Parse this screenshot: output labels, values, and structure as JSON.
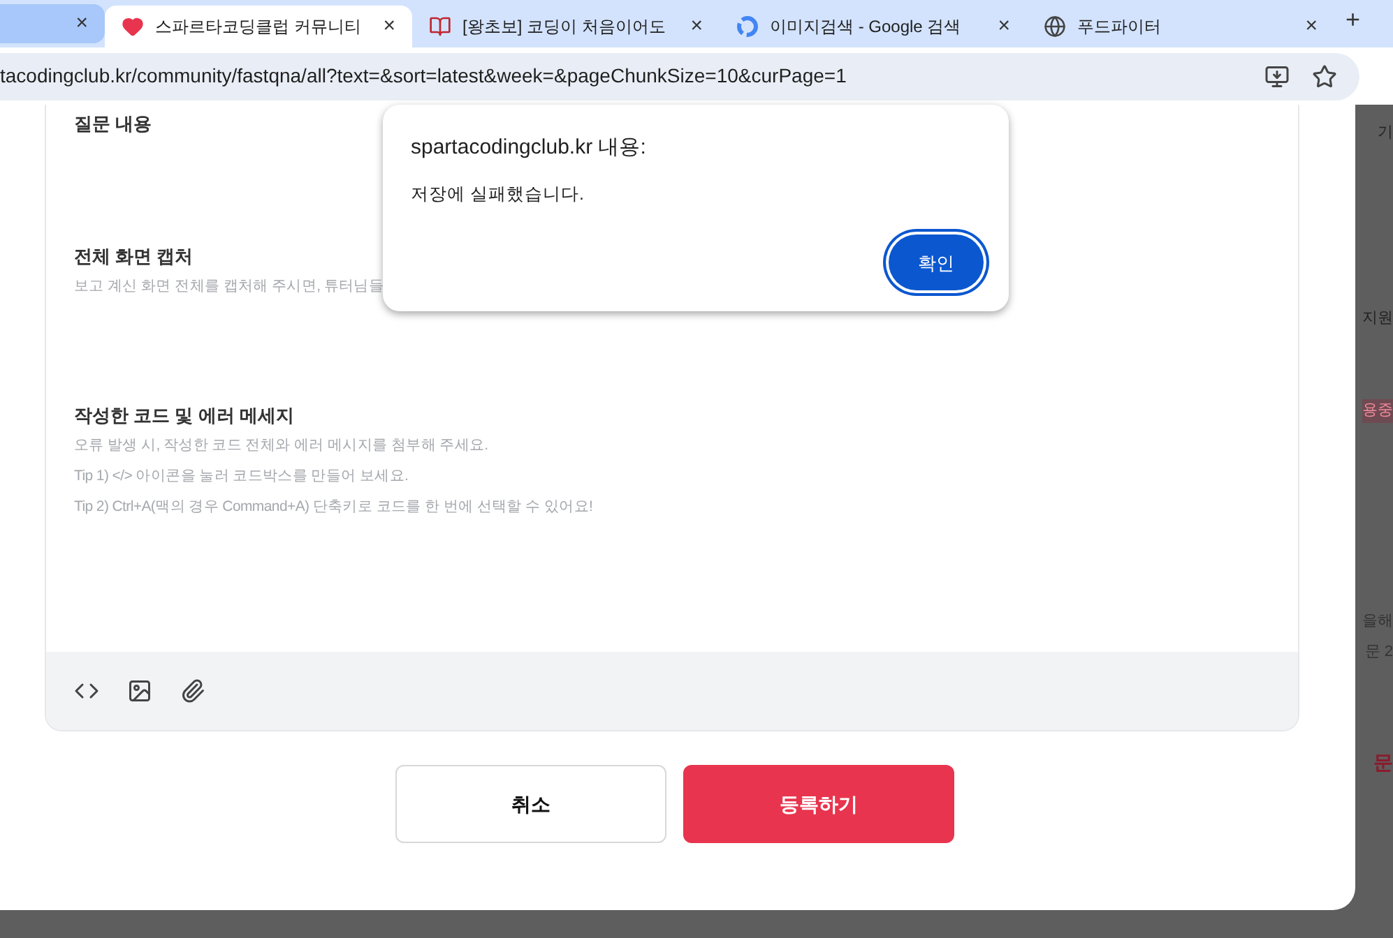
{
  "tabs": [
    {
      "kind": "partial",
      "selected": false,
      "close": "×"
    },
    {
      "kind": "tab",
      "title": "스파르타코딩클럽 커뮤니티",
      "selected": true,
      "close": "×"
    },
    {
      "kind": "tab",
      "title": "[왕초보] 코딩이 처음이어도",
      "selected": false,
      "close": "×"
    },
    {
      "kind": "tab",
      "title": "이미지검색 - Google 검색",
      "selected": false,
      "close": "×"
    },
    {
      "kind": "tab",
      "title": "푸드파이터",
      "selected": false,
      "close": "×"
    }
  ],
  "new_tab": "+",
  "address": "tacodingclub.kr/community/fastqna/all?text=&sort=latest&week=&pageChunkSize=10&curPage=1",
  "editor": {
    "sections": [
      {
        "heading": "질문 내용"
      },
      {
        "heading": "전체 화면 캡처",
        "hints": [
          "보고 계신 화면 전체를 캡처해 주시면, 튜터님들"
        ]
      },
      {
        "heading": "작성한 코드 및 에러 메세지",
        "hints": [
          "오류 발생 시, 작성한 코드 전체와 에러 메시지를 첨부해 주세요.",
          "Tip 1) </> 아이콘을 눌러 코드박스를 만들어 보세요.",
          "Tip 2) Ctrl+A(맥의 경우 Command+A) 단축키로 코드를 한 번에 선택할 수 있어요!"
        ]
      }
    ]
  },
  "buttons": {
    "cancel": "취소",
    "submit": "등록하기"
  },
  "background_texts": [
    "기",
    "지원",
    "용중",
    "을해",
    "문 2",
    "문"
  ],
  "dialog": {
    "title": "spartacodingclub.kr 내용:",
    "message": "저장에 실패했습니다.",
    "ok": "확인"
  }
}
